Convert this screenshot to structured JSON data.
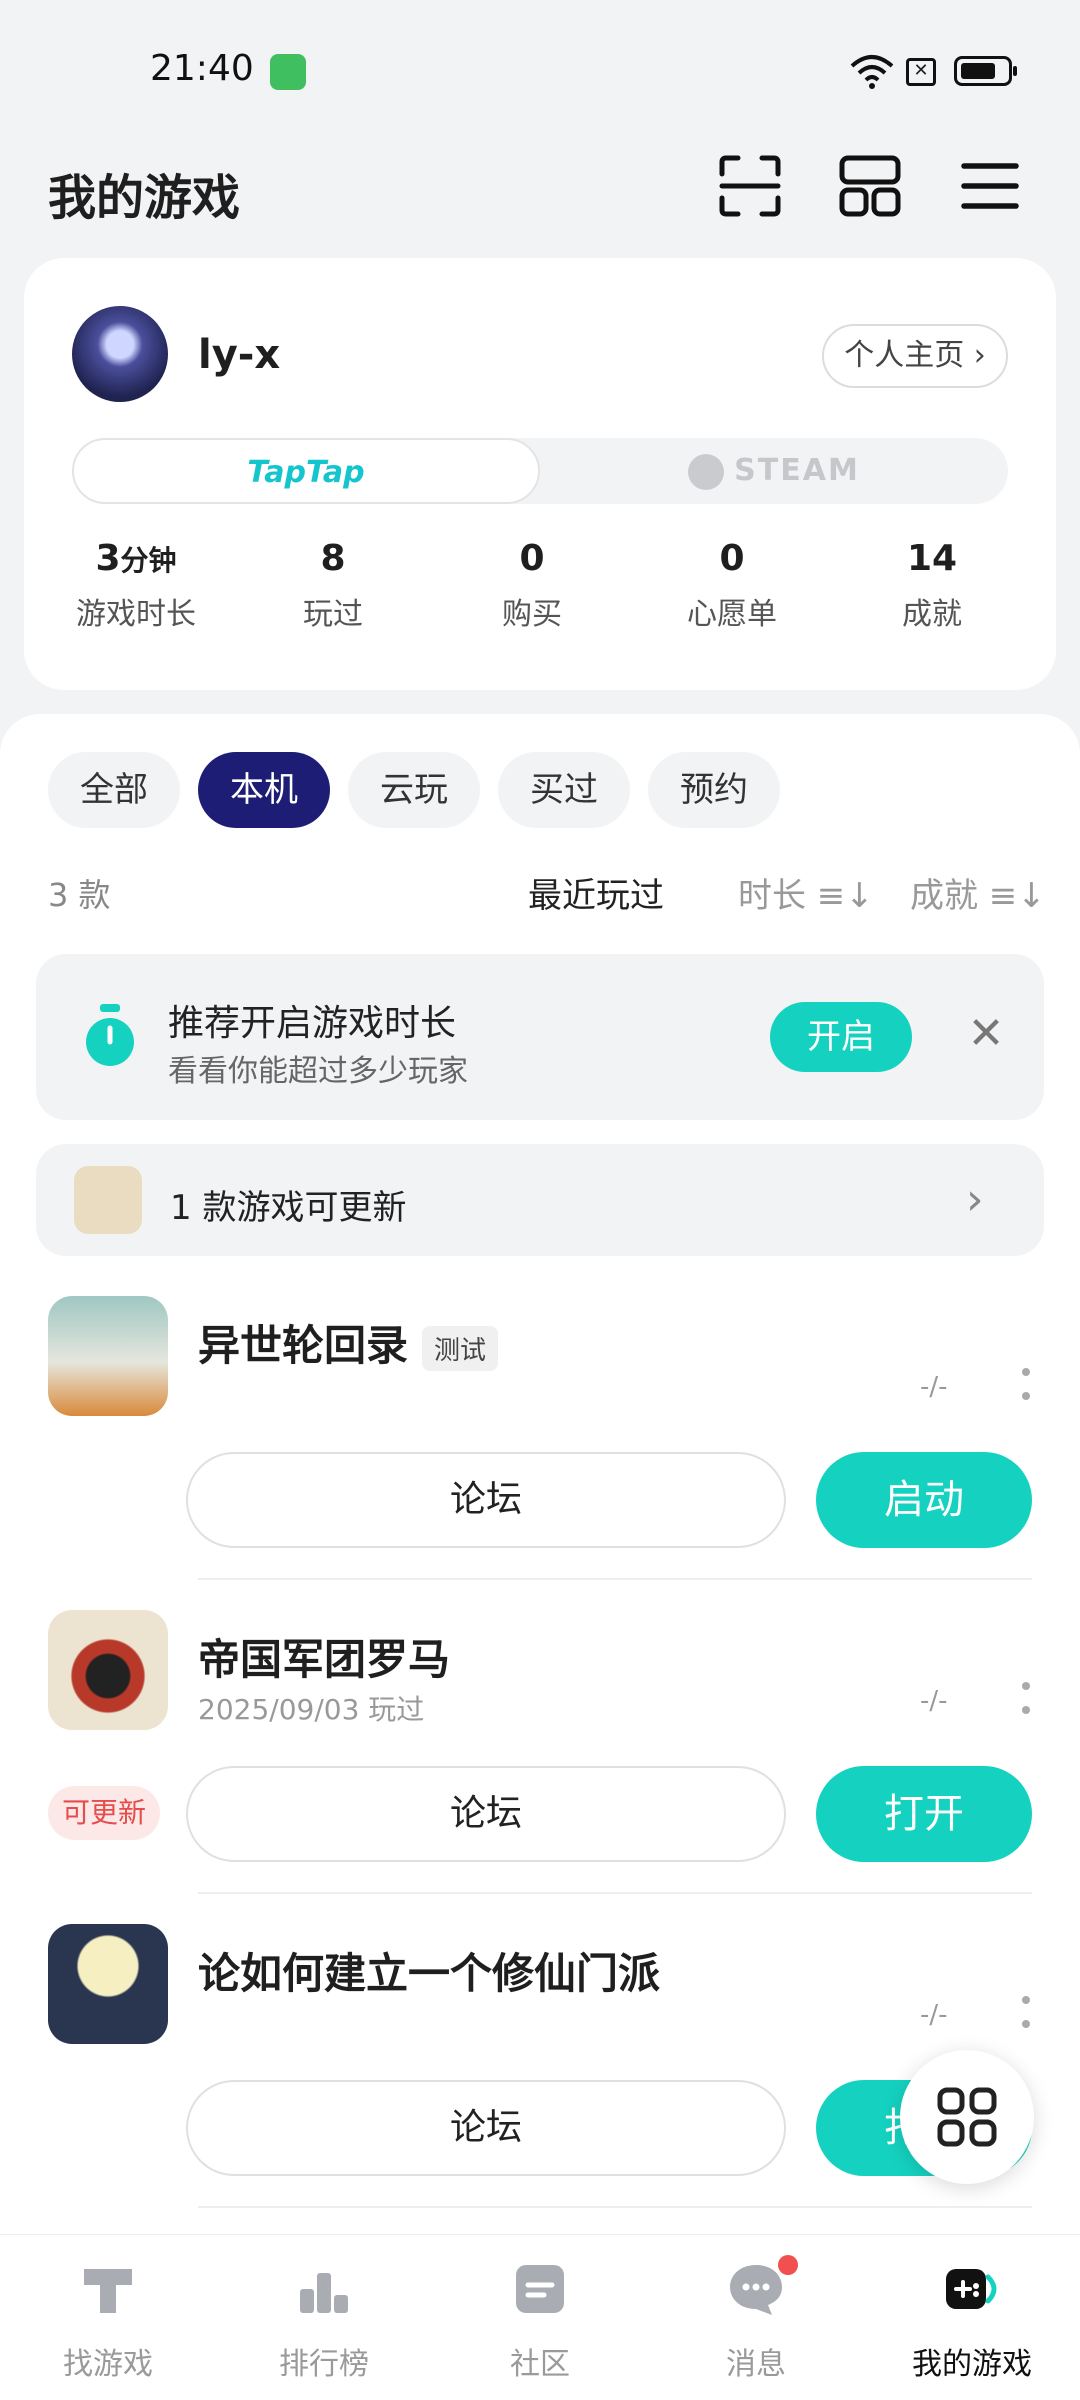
{
  "status": {
    "time": "21:40",
    "sim_label": "✕"
  },
  "header": {
    "title": "我的游戏"
  },
  "profile": {
    "username": "ly-x",
    "homepage": "个人主页 ›",
    "platforms": [
      "TapTap",
      "STEAM"
    ],
    "stats": [
      {
        "num": "3",
        "unit": "分钟",
        "label": "游戏时长"
      },
      {
        "num": "8",
        "unit": "",
        "label": "玩过"
      },
      {
        "num": "0",
        "unit": "",
        "label": "购买"
      },
      {
        "num": "0",
        "unit": "",
        "label": "心愿单"
      },
      {
        "num": "14",
        "unit": "",
        "label": "成就"
      }
    ]
  },
  "filters": [
    "全部",
    "本机",
    "云玩",
    "买过",
    "预约"
  ],
  "list": {
    "count": "3 款",
    "sort": [
      "最近玩过",
      "时长 ≡↓",
      "成就 ≡↓"
    ]
  },
  "reco": {
    "title": "推荐开启游戏时长",
    "subtitle": "看看你能超过多少玩家",
    "button": "开启",
    "close": "✕"
  },
  "update_bar": {
    "text": "1 款游戏可更新",
    "chevron": "›"
  },
  "games": [
    {
      "name": "异世轮回录",
      "tag": "测试",
      "sub": "",
      "dash": "-/-",
      "forum": "论坛",
      "action": "启动",
      "badge": ""
    },
    {
      "name": "帝国军团罗马",
      "tag": "",
      "sub": "2025/09/03 玩过",
      "dash": "-/-",
      "forum": "论坛",
      "action": "打开",
      "badge": "可更新"
    },
    {
      "name": "论如何建立一个修仙门派",
      "tag": "",
      "sub": "",
      "dash": "-/-",
      "forum": "论坛",
      "action": "打开",
      "badge": ""
    }
  ],
  "nav": [
    "找游戏",
    "排行榜",
    "社区",
    "消息",
    "我的游戏"
  ],
  "colors": {
    "accent": "#15d2c0",
    "active_chip": "#1d1d76",
    "update_badge": "#e74c4c"
  }
}
